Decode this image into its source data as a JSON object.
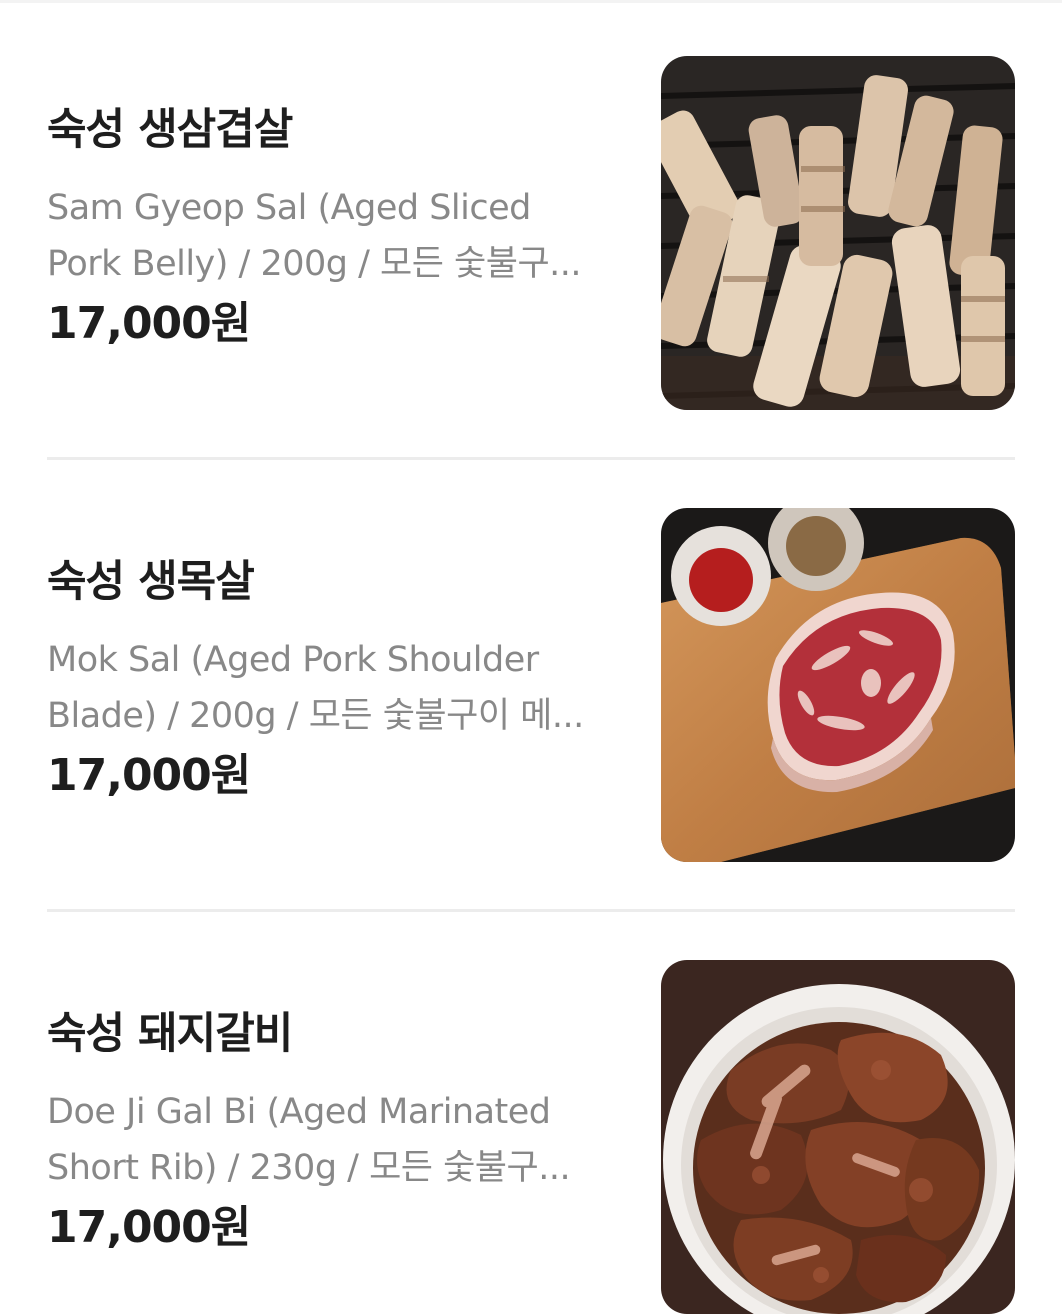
{
  "menu": {
    "items": [
      {
        "name": "숙성 생삼겹살",
        "desc_line1": "Sam Gyeop Sal (Aged Sliced",
        "desc_line2": "Pork Belly) / 200g / 모든 숯불구...",
        "price": "17,000원",
        "image": "grilled-pork-belly-photo"
      },
      {
        "name": "숙성 생목살",
        "desc_line1": "Mok Sal (Aged Pork Shoulder",
        "desc_line2": "Blade) / 200g / 모든 숯불구이 메...",
        "price": "17,000원",
        "image": "pork-shoulder-on-board-photo"
      },
      {
        "name": "숙성 돼지갈비",
        "desc_line1": "Doe Ji Gal Bi (Aged Marinated",
        "desc_line2": "Short Rib) / 230g / 모든 숯불구...",
        "price": "17,000원",
        "image": "marinated-short-rib-bowl-photo"
      }
    ]
  }
}
